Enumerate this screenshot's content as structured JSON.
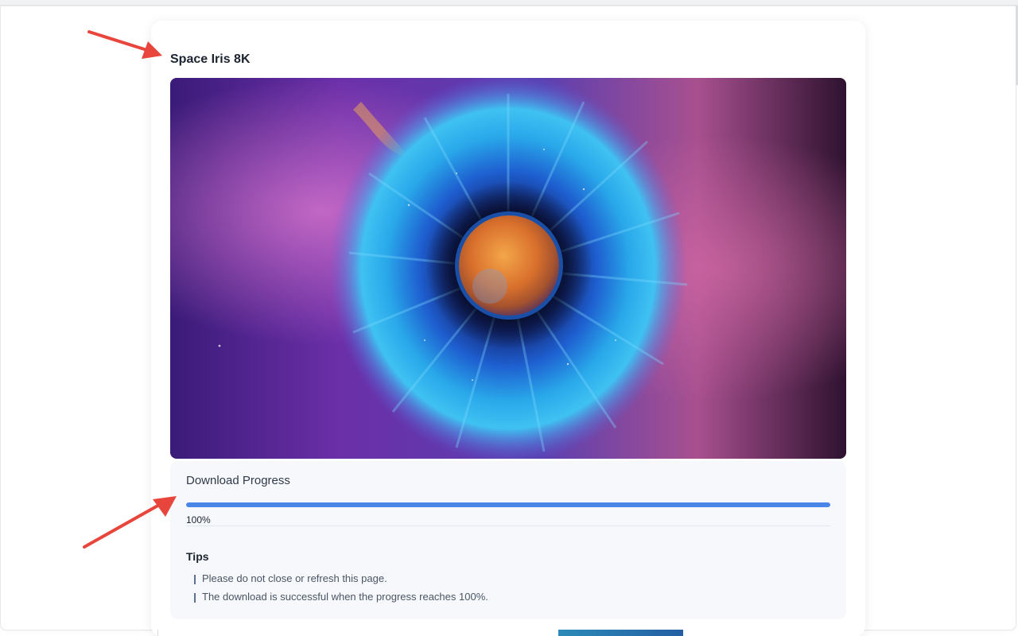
{
  "card": {
    "title": "Space Iris 8K"
  },
  "progress": {
    "title": "Download Progress",
    "value": 1.0,
    "percent_label": "100%"
  },
  "tips": {
    "title": "Tips",
    "items": [
      "Please do not close or refresh this page.",
      "The download is successful when the progress reaches 100%."
    ],
    "bullet_icon": "marker-icon"
  },
  "colors": {
    "progress_fill": "#4a86e8",
    "annotation_arrow": "#e8453c",
    "panel_bg": "#f6f8fb"
  }
}
